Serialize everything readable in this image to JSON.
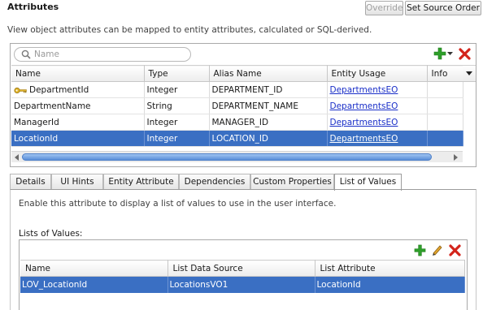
{
  "header": {
    "title": "Attributes",
    "override_label": "Override",
    "set_source_order_label": "Set Source Order",
    "description": "View object attributes can be mapped to entity attributes, calculated or SQL-derived."
  },
  "search": {
    "placeholder": "Name",
    "value": ""
  },
  "attributes_table": {
    "columns": [
      "Name",
      "Type",
      "Alias Name",
      "Entity Usage",
      "Info"
    ],
    "rows": [
      {
        "name": "DepartmentId",
        "type": "Integer",
        "alias": "DEPARTMENT_ID",
        "entity_usage": "DepartmentsEO",
        "info": "",
        "key_icon": true,
        "selected": false
      },
      {
        "name": "DepartmentName",
        "type": "String",
        "alias": "DEPARTMENT_NAME",
        "entity_usage": "DepartmentsEO",
        "info": "",
        "key_icon": false,
        "selected": false
      },
      {
        "name": "ManagerId",
        "type": "Integer",
        "alias": "MANAGER_ID",
        "entity_usage": "DepartmentsEO",
        "info": "",
        "key_icon": false,
        "selected": false
      },
      {
        "name": "LocationId",
        "type": "Integer",
        "alias": "LOCATION_ID",
        "entity_usage": "DepartmentsEO",
        "info": "",
        "key_icon": false,
        "selected": true
      }
    ]
  },
  "tabs": [
    {
      "label": "Details",
      "active": false
    },
    {
      "label": "UI Hints",
      "active": false
    },
    {
      "label": "Entity Attribute",
      "active": false
    },
    {
      "label": "Dependencies",
      "active": false
    },
    {
      "label": "Custom Properties",
      "active": false
    },
    {
      "label": "List of Values",
      "active": true
    }
  ],
  "lov": {
    "description": "Enable this attribute to display a list of values to use in the user interface.",
    "section_label": "Lists of Values:",
    "columns": [
      "Name",
      "List Data Source",
      "List Attribute"
    ],
    "rows": [
      {
        "name": "LOV_LocationId",
        "data_source": "LocationsVO1",
        "attribute": "LocationId",
        "selected": true
      }
    ]
  },
  "icons": {
    "add": "add-icon",
    "delete": "delete-icon",
    "edit": "edit-pencil-icon",
    "search": "search-icon",
    "key": "primary-key-icon"
  },
  "colors": {
    "selection": "#3a6fc3",
    "link": "#1a2fc8",
    "add_green": "#2e9e2a",
    "delete_red": "#d3241b"
  }
}
